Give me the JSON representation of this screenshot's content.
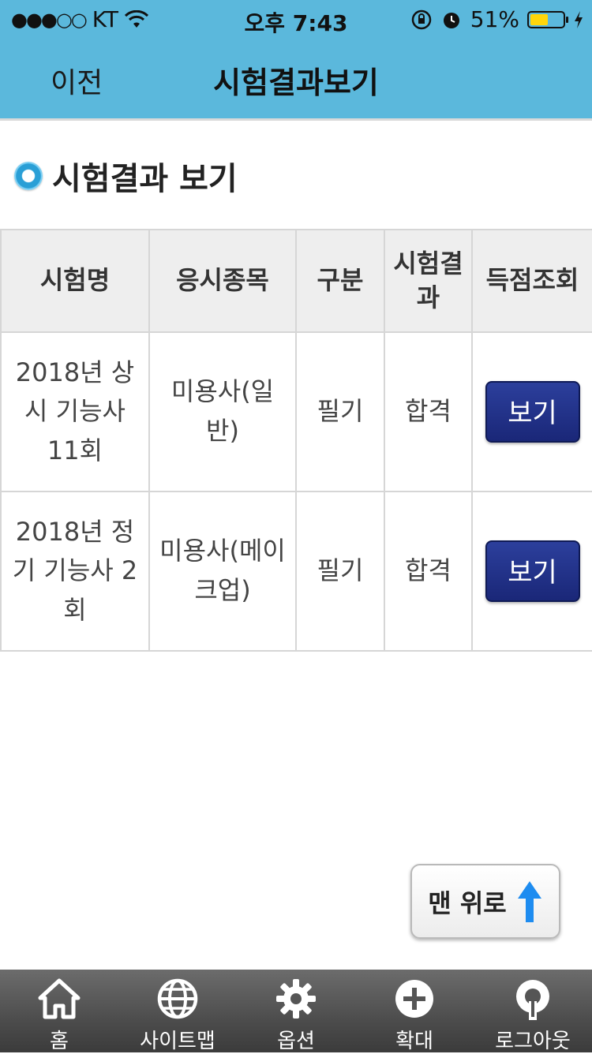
{
  "status_bar": {
    "signal": "●●●○○",
    "carrier": "KT",
    "time": "오후 7:43",
    "battery": "51%",
    "battery_level": 0.51
  },
  "nav": {
    "back_label": "이전",
    "title": "시험결과보기"
  },
  "section": {
    "title": "시험결과 보기"
  },
  "table": {
    "headers": [
      "시험명",
      "응시종목",
      "구분",
      "시험결과",
      "득점조회"
    ],
    "rows": [
      {
        "exam": "2018년 상시 기능사 11회",
        "subject": "미용사(일반)",
        "type": "필기",
        "result": "합격",
        "action": "보기"
      },
      {
        "exam": "2018년 정기 기능사 2회",
        "subject": "미용사(메이크업)",
        "type": "필기",
        "result": "합격",
        "action": "보기"
      }
    ]
  },
  "scroll_top": {
    "label": "맨 위로"
  },
  "tabbar": {
    "items": [
      {
        "label": "홈",
        "icon": "home-icon"
      },
      {
        "label": "사이트맵",
        "icon": "globe-icon"
      },
      {
        "label": "옵션",
        "icon": "gear-icon"
      },
      {
        "label": "확대",
        "icon": "plus-icon"
      },
      {
        "label": "로그아웃",
        "icon": "logout-icon"
      }
    ]
  },
  "colors": {
    "header_bg": "#5bb8dc",
    "button_bg": "#1f2e88",
    "tabbar_bg": "#4d4d4d"
  }
}
